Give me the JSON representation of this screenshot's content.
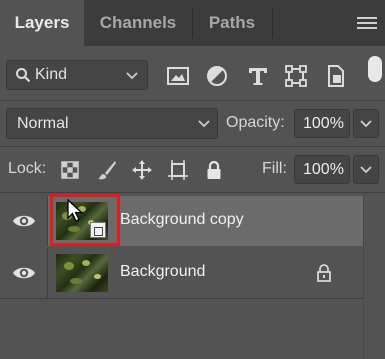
{
  "tabs": [
    {
      "label": "Layers",
      "active": true
    },
    {
      "label": "Channels",
      "active": false
    },
    {
      "label": "Paths",
      "active": false
    }
  ],
  "panel_menu_icon": "hamburger-menu-icon",
  "filter": {
    "kind_label": "Kind",
    "icons": [
      "image-filter-icon",
      "adjustment-filter-icon",
      "type-filter-icon",
      "shape-filter-icon",
      "smart-object-filter-icon"
    ]
  },
  "blend_mode": "Normal",
  "opacity": {
    "label": "Opacity:",
    "value": "100%"
  },
  "lock": {
    "label": "Lock:",
    "icons": [
      "lock-transparent-pixels-icon",
      "lock-image-pixels-icon",
      "lock-position-icon",
      "lock-artboard-icon",
      "lock-all-icon"
    ]
  },
  "fill": {
    "label": "Fill:",
    "value": "100%"
  },
  "layers": [
    {
      "name": "Background copy",
      "visible": true,
      "selected": true,
      "smart_object": true
    },
    {
      "name": "Background",
      "visible": true,
      "selected": false,
      "locked": true
    }
  ],
  "colors": {
    "panel_bg": "#535353",
    "tab_bg": "#3c3c3c",
    "selected_row": "#6b6b6b",
    "highlight_frame": "#e01d1d"
  }
}
